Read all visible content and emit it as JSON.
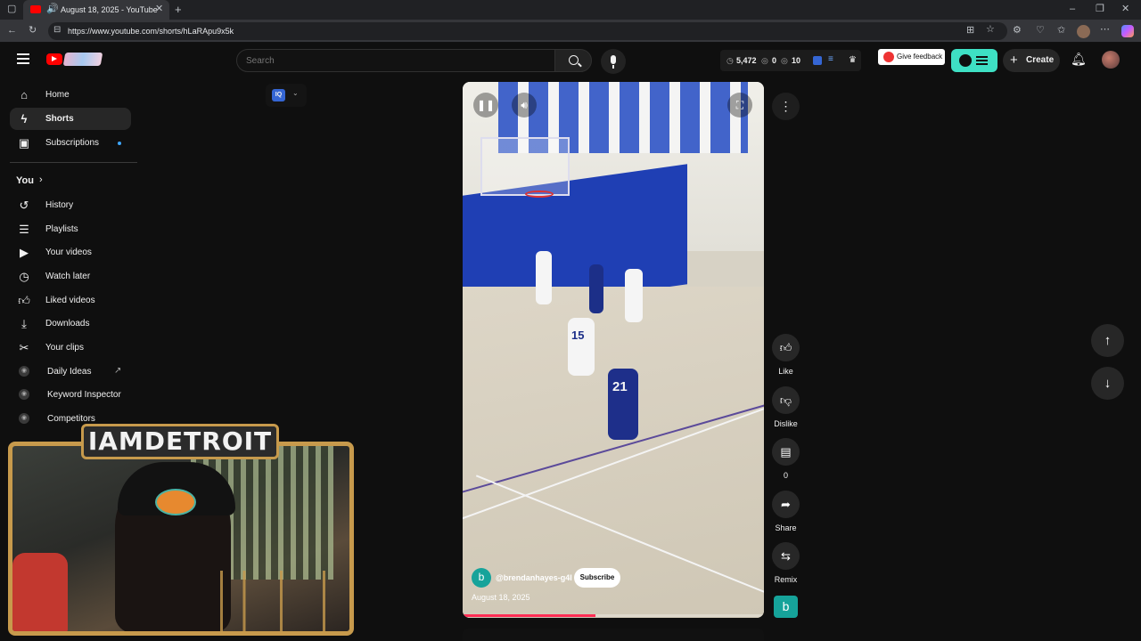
{
  "browser": {
    "tab_title": "August 18, 2025 - YouTube",
    "new_tab_icon": "plus-icon",
    "url": "https://www.youtube.com/shorts/hLaRApu9x5k"
  },
  "header": {
    "search_placeholder": "Search",
    "stats": {
      "subs": "5,472",
      "views": "0",
      "hidden": "10"
    },
    "feedback_label": "Give feedback",
    "create_label": "Create"
  },
  "sidebar": {
    "primary": [
      {
        "label": "Home",
        "icon": "home-icon"
      },
      {
        "label": "Shorts",
        "icon": "shorts-icon"
      },
      {
        "label": "Subscriptions",
        "icon": "subscriptions-icon"
      }
    ],
    "you_label": "You",
    "you_items": [
      {
        "label": "History",
        "icon": "history-icon"
      },
      {
        "label": "Playlists",
        "icon": "playlists-icon"
      },
      {
        "label": "Your videos",
        "icon": "your-videos-icon"
      },
      {
        "label": "Watch later",
        "icon": "watch-later-icon"
      },
      {
        "label": "Liked videos",
        "icon": "like-icon"
      },
      {
        "label": "Downloads",
        "icon": "download-icon"
      },
      {
        "label": "Your clips",
        "icon": "scissors-icon"
      },
      {
        "label": "Daily Ideas",
        "icon": "vidiq-icon"
      },
      {
        "label": "Keyword Inspector",
        "icon": "vidiq-icon"
      },
      {
        "label": "Competitors",
        "icon": "vidiq-icon"
      }
    ]
  },
  "overlay": {
    "banner_text": "IAMDETROIT"
  },
  "video": {
    "channel_avatar_letter": "b",
    "channel_handle": "@brendanhayes-g4l",
    "subscribe_label": "Subscribe",
    "date": "August 18, 2025",
    "progress": 0.44,
    "extension_badge": "IQ",
    "jersey_left": "15",
    "jersey_right": "21"
  },
  "actions": {
    "like_label": "Like",
    "dislike_label": "Dislike",
    "comments_count": "0",
    "share_label": "Share",
    "remix_label": "Remix",
    "channel_letter": "b"
  }
}
